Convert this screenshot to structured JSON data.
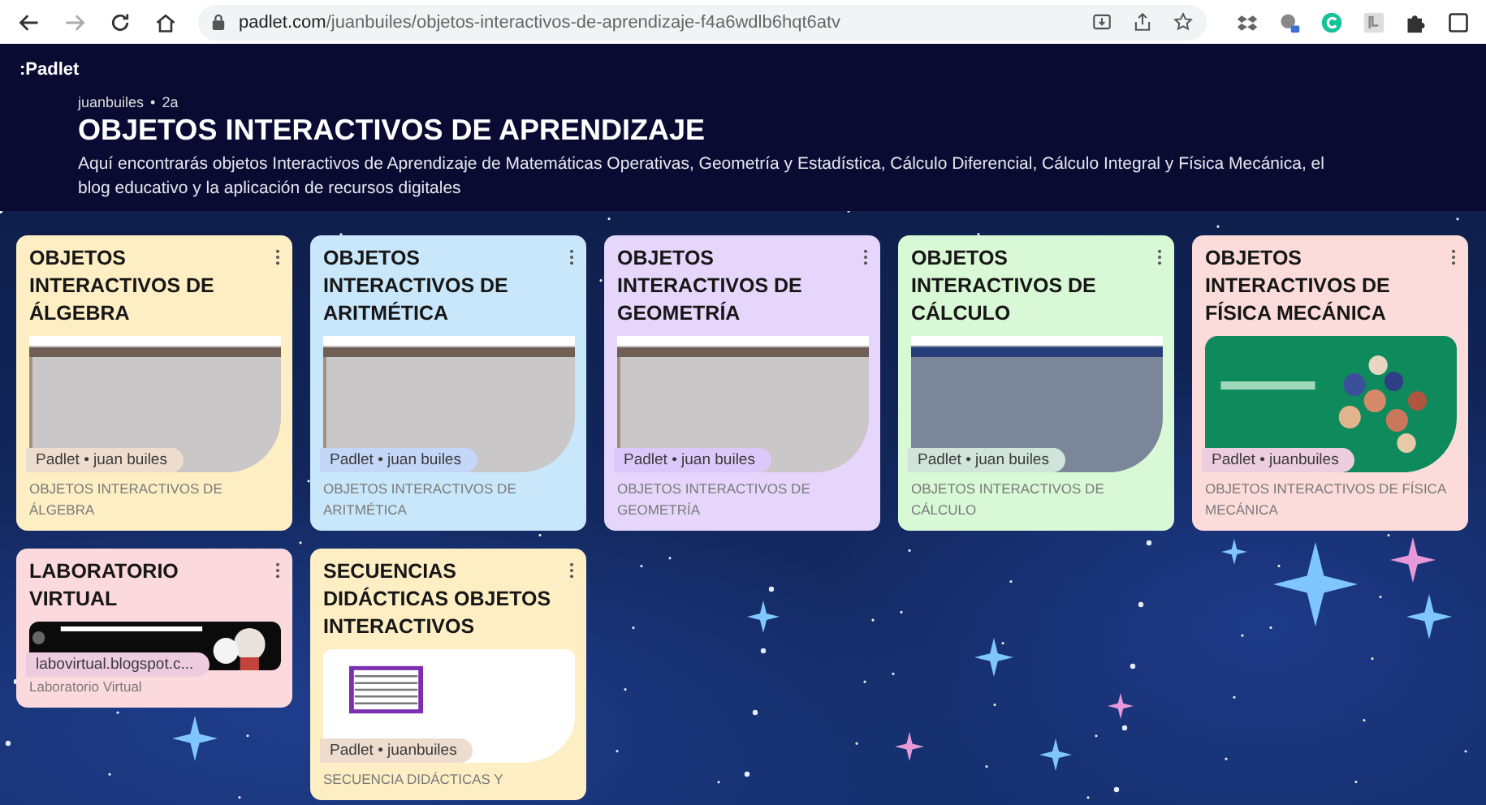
{
  "browser": {
    "url_host": "padlet.com",
    "url_path": "/juanbuiles/objetos-interactivos-de-aprendizaje-f4a6wdlb6hqt6atv",
    "forward_disabled": true
  },
  "header": {
    "logo": ":Padlet",
    "author": "juanbuiles",
    "separator": "•",
    "age": "2a",
    "title": "OBJETOS INTERACTIVOS DE APRENDIZAJE",
    "description": "Aquí encontrarás objetos Interactivos de Aprendizaje de Matemáticas Operativas, Geometría y Estadística, Cálculo Diferencial, Cálculo Integral y Física Mecánica, el blog educativo y la aplicación de recursos digitales"
  },
  "columns": [
    {
      "cards": [
        {
          "title": "OBJETOS INTERACTIVOS DE ÁLGEBRA",
          "color": "#fdeec4",
          "preview": {
            "kind": "page-gray"
          },
          "attribution": "Padlet • juan builes",
          "caption": "OBJETOS INTERACTIVOS DE ÁLGEBRA"
        },
        {
          "title": "LABORATORIO VIRTUAL",
          "color": "#fcd9dc",
          "preview": {
            "kind": "banner"
          },
          "attribution": "labovirtual.blogspot.c...",
          "caption": "Laboratorio Virtual"
        }
      ]
    },
    {
      "cards": [
        {
          "title": "OBJETOS INTERACTIVOS DE ARITMÉTICA",
          "color": "#c8e7fa",
          "preview": {
            "kind": "page-gray"
          },
          "attribution": "Padlet • juan builes",
          "caption": "OBJETOS INTERACTIVOS DE ARITMÉTICA"
        },
        {
          "title": "SECUENCIAS DIDÁCTICAS OBJETOS INTERACTIVOS",
          "color": "#fdeec4",
          "preview": {
            "kind": "document"
          },
          "attribution": "Padlet • juanbuiles",
          "caption": "SECUENCIA DIDÁCTICAS Y"
        }
      ]
    },
    {
      "cards": [
        {
          "title": "OBJETOS INTERACTIVOS DE GEOMETRÍA",
          "color": "#e6d6fb",
          "preview": {
            "kind": "page-gray"
          },
          "attribution": "Padlet • juan builes",
          "caption": "OBJETOS INTERACTIVOS DE GEOMETRÍA"
        }
      ]
    },
    {
      "cards": [
        {
          "title": "OBJETOS INTERACTIVOS DE CÁLCULO",
          "color": "#d8f8d6",
          "preview": {
            "kind": "page-blue"
          },
          "attribution": "Padlet • juan builes",
          "caption": "OBJETOS INTERACTIVOS DE CÁLCULO"
        }
      ]
    },
    {
      "cards": [
        {
          "title": "OBJETOS INTERACTIVOS DE FÍSICA MECÁNICA",
          "color": "#fcdcda",
          "attribution": "Padlet • juanbuiles",
          "caption": "OBJETOS INTERACTIVOS DE FÍSICA MECÁNICA"
        }
      ]
    }
  ]
}
